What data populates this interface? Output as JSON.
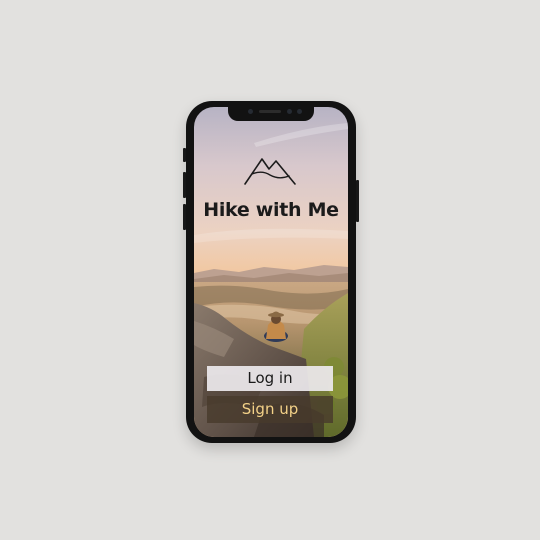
{
  "app": {
    "title": "Hike with Me",
    "logo_icon": "mountain-icon"
  },
  "actions": {
    "login_label": "Log in",
    "signup_label": "Sign up"
  },
  "colors": {
    "background": "#e2e1df",
    "phone_frame": "#121212",
    "login_button_bg": "#ece8ec",
    "signup_button_bg": "#483a2c",
    "signup_text": "#f3d188",
    "title_text": "#1b1b1b"
  }
}
